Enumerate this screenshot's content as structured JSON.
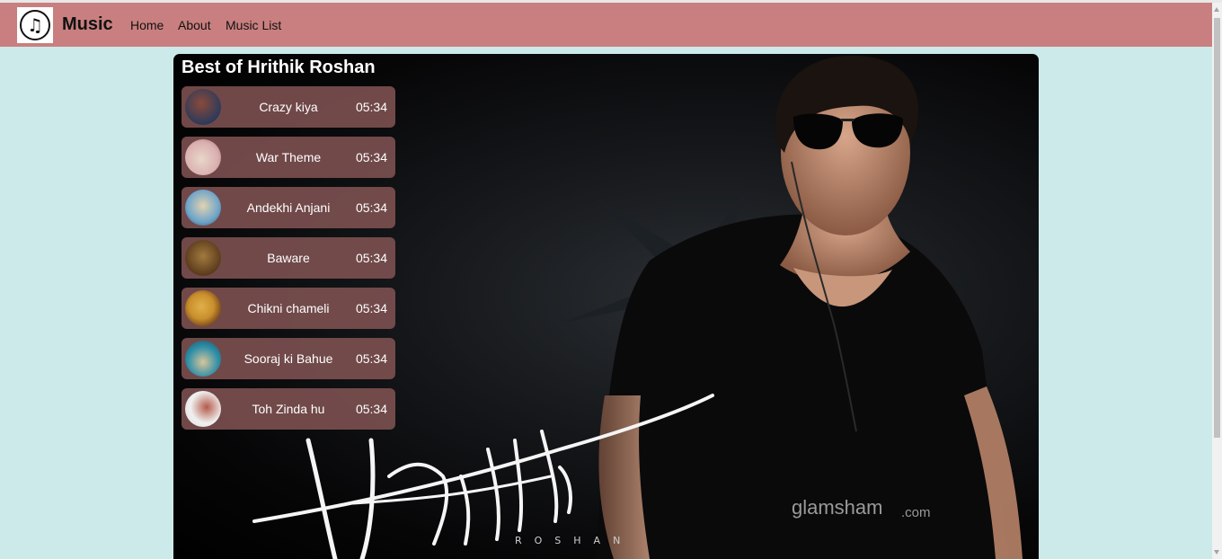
{
  "header": {
    "brand": "Music",
    "nav": [
      "Home",
      "About",
      "Music List"
    ],
    "background_color": "#c97f7f"
  },
  "page": {
    "title": "Best of Hrithik Roshan",
    "background_color": "#cdeaea"
  },
  "banner": {
    "signature_text": "Hrithik",
    "signature_sub": "ROSHAN",
    "watermark": "glamsham",
    "watermark_suffix": ".com"
  },
  "songs": [
    {
      "name": "Crazy kiya",
      "duration": "05:34",
      "thumb_colors": [
        "#8a4a3a",
        "#2d3a5a"
      ]
    },
    {
      "name": "War Theme",
      "duration": "05:34",
      "thumb_colors": [
        "#d9b0b0",
        "#e9d6c8"
      ]
    },
    {
      "name": "Andekhi Anjani",
      "duration": "05:34",
      "thumb_colors": [
        "#6fa5c9",
        "#e2d2b0"
      ]
    },
    {
      "name": "Baware",
      "duration": "05:34",
      "thumb_colors": [
        "#a27a3d",
        "#5b3b1d"
      ]
    },
    {
      "name": "Chikni chameli",
      "duration": "05:34",
      "thumb_colors": [
        "#c98f2c",
        "#6b3b1a"
      ]
    },
    {
      "name": "Sooraj ki Bahue",
      "duration": "05:34",
      "thumb_colors": [
        "#2f8fa8",
        "#d8c59a"
      ]
    },
    {
      "name": "Toh Zinda hu",
      "duration": "05:34",
      "thumb_colors": [
        "#f0f0f0",
        "#b45a4a"
      ]
    }
  ]
}
